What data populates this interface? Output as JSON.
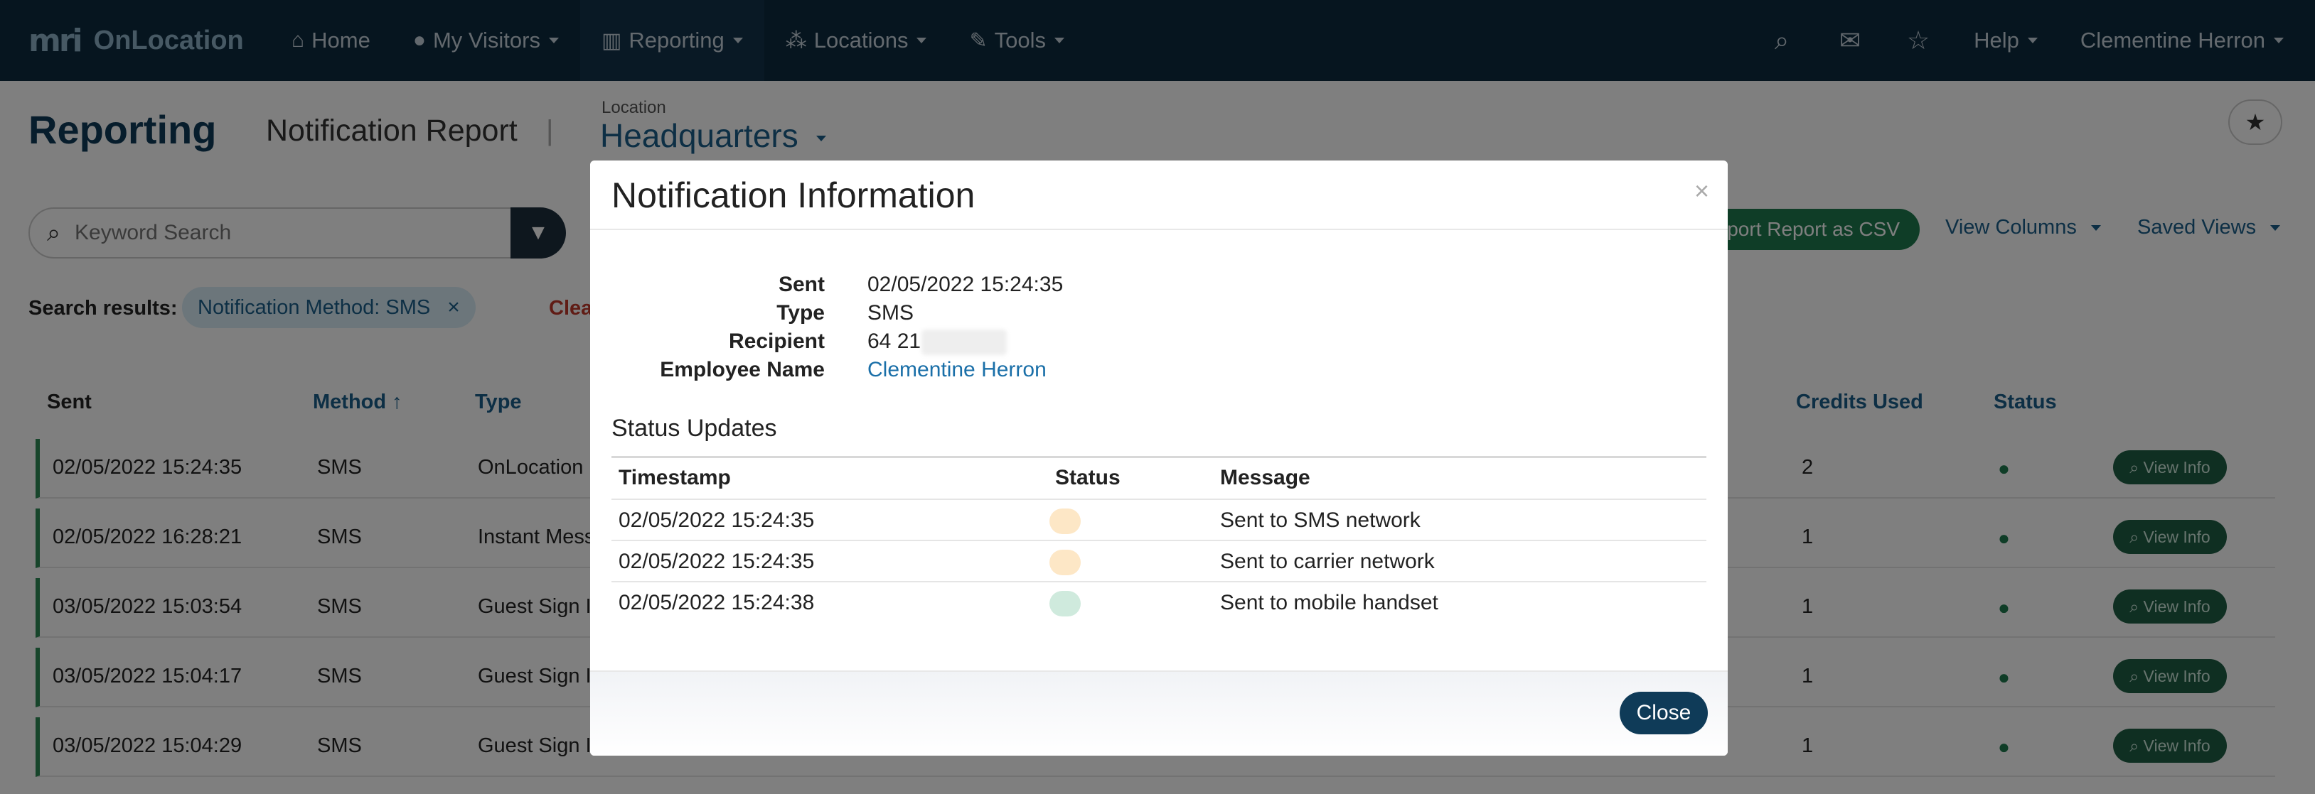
{
  "navbar": {
    "brand_mark": "mri",
    "brand_name": "OnLocation",
    "items": [
      {
        "label": "Home",
        "icon": "home-icon"
      },
      {
        "label": "My Visitors",
        "icon": "user-icon"
      },
      {
        "label": "Reporting",
        "icon": "chart-icon"
      },
      {
        "label": "Locations",
        "icon": "sitemap-icon"
      },
      {
        "label": "Tools",
        "icon": "wrench-icon"
      }
    ],
    "help_label": "Help",
    "user_name": "Clementine Herron"
  },
  "page": {
    "title": "Reporting",
    "report_title": "Notification Report",
    "separator": "|",
    "location_label": "Location",
    "location_value": "Headquarters"
  },
  "search": {
    "placeholder": "Keyword Search",
    "export_label": "Export Report as CSV",
    "view_columns_label": "View Columns",
    "saved_views_label": "Saved Views",
    "results_label": "Search results:",
    "chip_label": "Notification Method: SMS",
    "clear_label": "Clear"
  },
  "table": {
    "headers": {
      "sent": "Sent",
      "method": "Method",
      "method_sort": "↑",
      "type": "Type",
      "credits": "Credits Used",
      "status": "Status"
    },
    "view_info_label": "View Info",
    "rows": [
      {
        "sent": "02/05/2022 15:24:35",
        "method": "SMS",
        "type": "OnLocation",
        "credits": "2"
      },
      {
        "sent": "02/05/2022 16:28:21",
        "method": "SMS",
        "type": "Instant Mess",
        "credits": "1"
      },
      {
        "sent": "03/05/2022 15:03:54",
        "method": "SMS",
        "type": "Guest Sign I",
        "credits": "1"
      },
      {
        "sent": "03/05/2022 15:04:17",
        "method": "SMS",
        "type": "Guest Sign I",
        "credits": "1"
      },
      {
        "sent": "03/05/2022 15:04:29",
        "method": "SMS",
        "type": "Guest Sign I",
        "credits": "1"
      }
    ]
  },
  "modal": {
    "title": "Notification Information",
    "close_x": "×",
    "details": {
      "sent_label": "Sent",
      "sent_value": "02/05/2022 15:24:35",
      "type_label": "Type",
      "type_value": "SMS",
      "recipient_label": "Recipient",
      "recipient_value": "64 21",
      "employee_label": "Employee Name",
      "employee_value": "Clementine Herron"
    },
    "updates_title": "Status Updates",
    "updates_headers": {
      "timestamp": "Timestamp",
      "status": "Status",
      "message": "Message"
    },
    "updates": [
      {
        "timestamp": "02/05/2022 15:24:35",
        "status_color": "#fde7c6",
        "message": "Sent to SMS network"
      },
      {
        "timestamp": "02/05/2022 15:24:35",
        "status_color": "#fde7c6",
        "message": "Sent to carrier network"
      },
      {
        "timestamp": "02/05/2022 15:24:38",
        "status_color": "#cfeadd",
        "message": "Sent to mobile handset"
      }
    ],
    "close_label": "Close"
  }
}
